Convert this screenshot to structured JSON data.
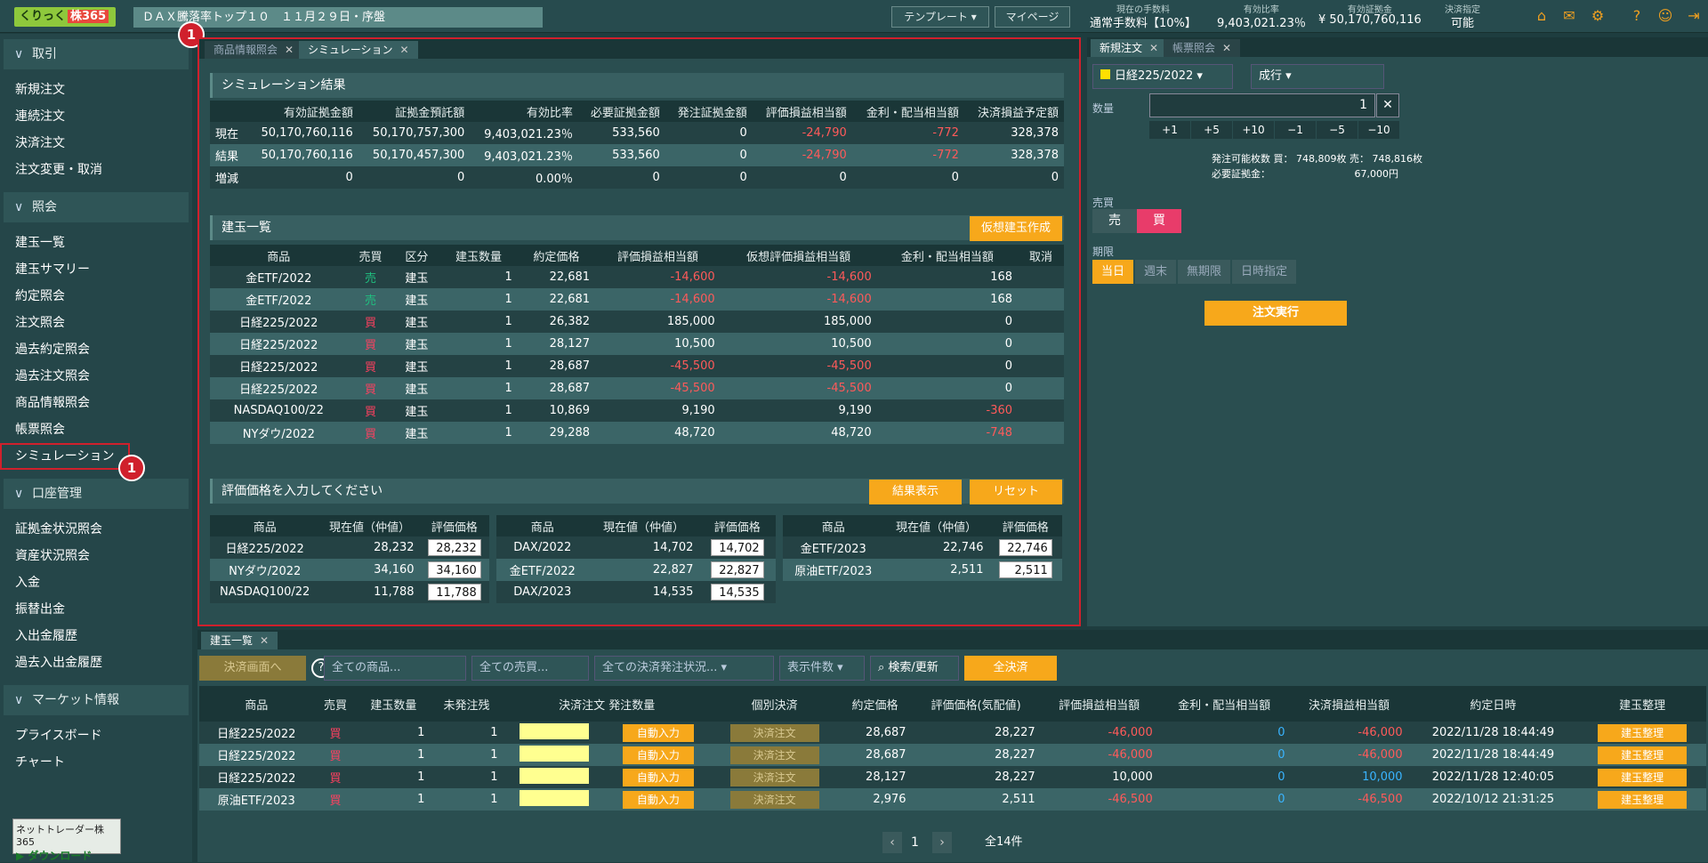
{
  "header": {
    "logo_a": "くりっく",
    "logo_b": "株365",
    "ticker": "ＤＡＸ騰落率トップ１０　１１月２９日・序盤",
    "template_label": "テンプレート",
    "mypage_label": "マイページ",
    "summary": [
      {
        "caption": "現在の手数料",
        "value": "通常手数料【10%】"
      },
      {
        "caption": "有効比率",
        "value": "9,403,021.23％"
      },
      {
        "caption": "有効証拠金",
        "value": "¥ 50,170,760,116"
      },
      {
        "caption": "決済指定",
        "value": "可能"
      }
    ],
    "icons": [
      "home-icon",
      "mail-icon",
      "gear-icon",
      "help-icon",
      "user-icon",
      "logout-icon"
    ]
  },
  "sidebar": {
    "sections": [
      {
        "title": "取引",
        "items": [
          "新規注文",
          "連続注文",
          "決済注文",
          "注文変更・取消"
        ]
      },
      {
        "title": "照会",
        "items": [
          "建玉一覧",
          "建玉サマリー",
          "約定照会",
          "注文照会",
          "過去約定照会",
          "過去注文照会",
          "商品情報照会",
          "帳票照会",
          "シミュレーション"
        ]
      },
      {
        "title": "口座管理",
        "items": [
          "証拠金状況照会",
          "資産状況照会",
          "入金",
          "振替出金",
          "入出金履歴",
          "過去入出金履歴"
        ]
      },
      {
        "title": "マーケット情報",
        "items": [
          "プライスボード",
          "チャート"
        ]
      }
    ],
    "download_a": "ネットトレーダー株365",
    "download_b": "ダウンロード",
    "badge": "1"
  },
  "main": {
    "tabs": [
      "商品情報照会",
      "シミュレーション"
    ],
    "sim_title": "シミュレーション結果",
    "sim_headers": [
      "",
      "有効証拠金額",
      "証拠金預託額",
      "有効比率",
      "必要証拠金額",
      "発注証拠金額",
      "評価損益相当額",
      "金利・配当相当額",
      "決済損益予定額"
    ],
    "sim_rows": [
      [
        "現在",
        "50,170,760,116",
        "50,170,757,300",
        "9,403,021.23％",
        "533,560",
        "0",
        "-24,790",
        "-772",
        "328,378"
      ],
      [
        "結果",
        "50,170,760,116",
        "50,170,457,300",
        "9,403,021.23％",
        "533,560",
        "0",
        "-24,790",
        "-772",
        "328,378"
      ],
      [
        "増減",
        "0",
        "0",
        "0.00％",
        "0",
        "0",
        "0",
        "0",
        "0"
      ]
    ],
    "pos_title": "建玉一覧",
    "virtual_btn": "仮想建玉作成",
    "pos_headers": [
      "商品",
      "売買",
      "区分",
      "建玉数量",
      "約定価格",
      "評価損益相当額",
      "仮想評価損益相当額",
      "金利・配当相当額",
      "取消"
    ],
    "pos_rows": [
      [
        "金ETF/2022",
        "売",
        "建玉",
        "1",
        "22,681",
        "-14,600",
        "-14,600",
        "168",
        ""
      ],
      [
        "金ETF/2022",
        "売",
        "建玉",
        "1",
        "22,681",
        "-14,600",
        "-14,600",
        "168",
        ""
      ],
      [
        "日経225/2022",
        "買",
        "建玉",
        "1",
        "26,382",
        "185,000",
        "185,000",
        "0",
        ""
      ],
      [
        "日経225/2022",
        "買",
        "建玉",
        "1",
        "28,127",
        "10,500",
        "10,500",
        "0",
        ""
      ],
      [
        "日経225/2022",
        "買",
        "建玉",
        "1",
        "28,687",
        "-45,500",
        "-45,500",
        "0",
        ""
      ],
      [
        "日経225/2022",
        "買",
        "建玉",
        "1",
        "28,687",
        "-45,500",
        "-45,500",
        "0",
        ""
      ],
      [
        "NASDAQ100/22",
        "買",
        "建玉",
        "1",
        "10,869",
        "9,190",
        "9,190",
        "-360",
        ""
      ],
      [
        "NYダウ/2022",
        "買",
        "建玉",
        "1",
        "29,288",
        "48,720",
        "48,720",
        "-748",
        ""
      ]
    ],
    "eval_title": "評価価格を入力してください",
    "result_btn": "結果表示",
    "reset_btn": "リセット",
    "eval_headers": [
      "商品",
      "現在値（仲値）",
      "評価価格"
    ],
    "eval_tables": [
      [
        [
          "日経225/2022",
          "28,232",
          "28,232"
        ],
        [
          "NYダウ/2022",
          "34,160",
          "34,160"
        ],
        [
          "NASDAQ100/22",
          "11,788",
          "11,788"
        ]
      ],
      [
        [
          "DAX/2022",
          "14,702",
          "14,702"
        ],
        [
          "金ETF/2022",
          "22,827",
          "22,827"
        ],
        [
          "DAX/2023",
          "14,535",
          "14,535"
        ]
      ],
      [
        [
          "金ETF/2023",
          "22,746",
          "22,746"
        ],
        [
          "原油ETF/2023",
          "2,511",
          "2,511"
        ]
      ]
    ]
  },
  "order": {
    "tabs": [
      "新規注文",
      "帳票照会"
    ],
    "product": "日経225/2022",
    "type": "成行",
    "qty_label": "数量",
    "qty": "1",
    "steps": [
      "+1",
      "+5",
      "+10",
      "−1",
      "−5",
      "−10"
    ],
    "avail_a": "発注可能枚数 買：",
    "avail_b": "748,809枚",
    "avail_c": "売：",
    "avail_d": "748,816枚",
    "margin_label": "必要証拠金：",
    "margin": "67,000円",
    "side_label": "売買",
    "sell": "売",
    "buy": "買",
    "term_label": "期限",
    "terms": [
      "当日",
      "週末",
      "無期限",
      "日時指定"
    ],
    "exec": "注文実行"
  },
  "bottom": {
    "tab": "建玉一覧",
    "settle_btn": "決済画面へ",
    "f1": "全ての商品...",
    "f2": "全ての売買...",
    "f3": "全ての決済発注状況...",
    "f4": "表示件数",
    "search": "検索/更新",
    "all_settle": "全決済",
    "headers": [
      "商品",
      "売買",
      "建玉数量",
      "未発注残",
      "決済注文 発注数量",
      "",
      "個別決済",
      "約定価格",
      "評価価格(気配値)",
      "評価損益相当額",
      "金利・配当相当額",
      "決済損益相当額",
      "約定日時",
      "建玉整理"
    ],
    "rows": [
      [
        "日経225/2022",
        "買",
        "1",
        "1",
        "自動入力",
        "決済注文",
        "28,687",
        "28,227",
        "-46,000",
        "0",
        "-46,000",
        "2022/11/28 18:44:49",
        "建玉整理"
      ],
      [
        "日経225/2022",
        "買",
        "1",
        "1",
        "自動入力",
        "決済注文",
        "28,687",
        "28,227",
        "-46,000",
        "0",
        "-46,000",
        "2022/11/28 18:44:49",
        "建玉整理"
      ],
      [
        "日経225/2022",
        "買",
        "1",
        "1",
        "自動入力",
        "決済注文",
        "28,127",
        "28,227",
        "10,000",
        "0",
        "10,000",
        "2022/11/28 12:40:05",
        "建玉整理"
      ],
      [
        "原油ETF/2023",
        "買",
        "1",
        "1",
        "自動入力",
        "決済注文",
        "2,976",
        "2,511",
        "-46,500",
        "0",
        "-46,500",
        "2022/10/12 21:31:25",
        "建玉整理"
      ]
    ],
    "page": "1",
    "total": "全14件"
  }
}
